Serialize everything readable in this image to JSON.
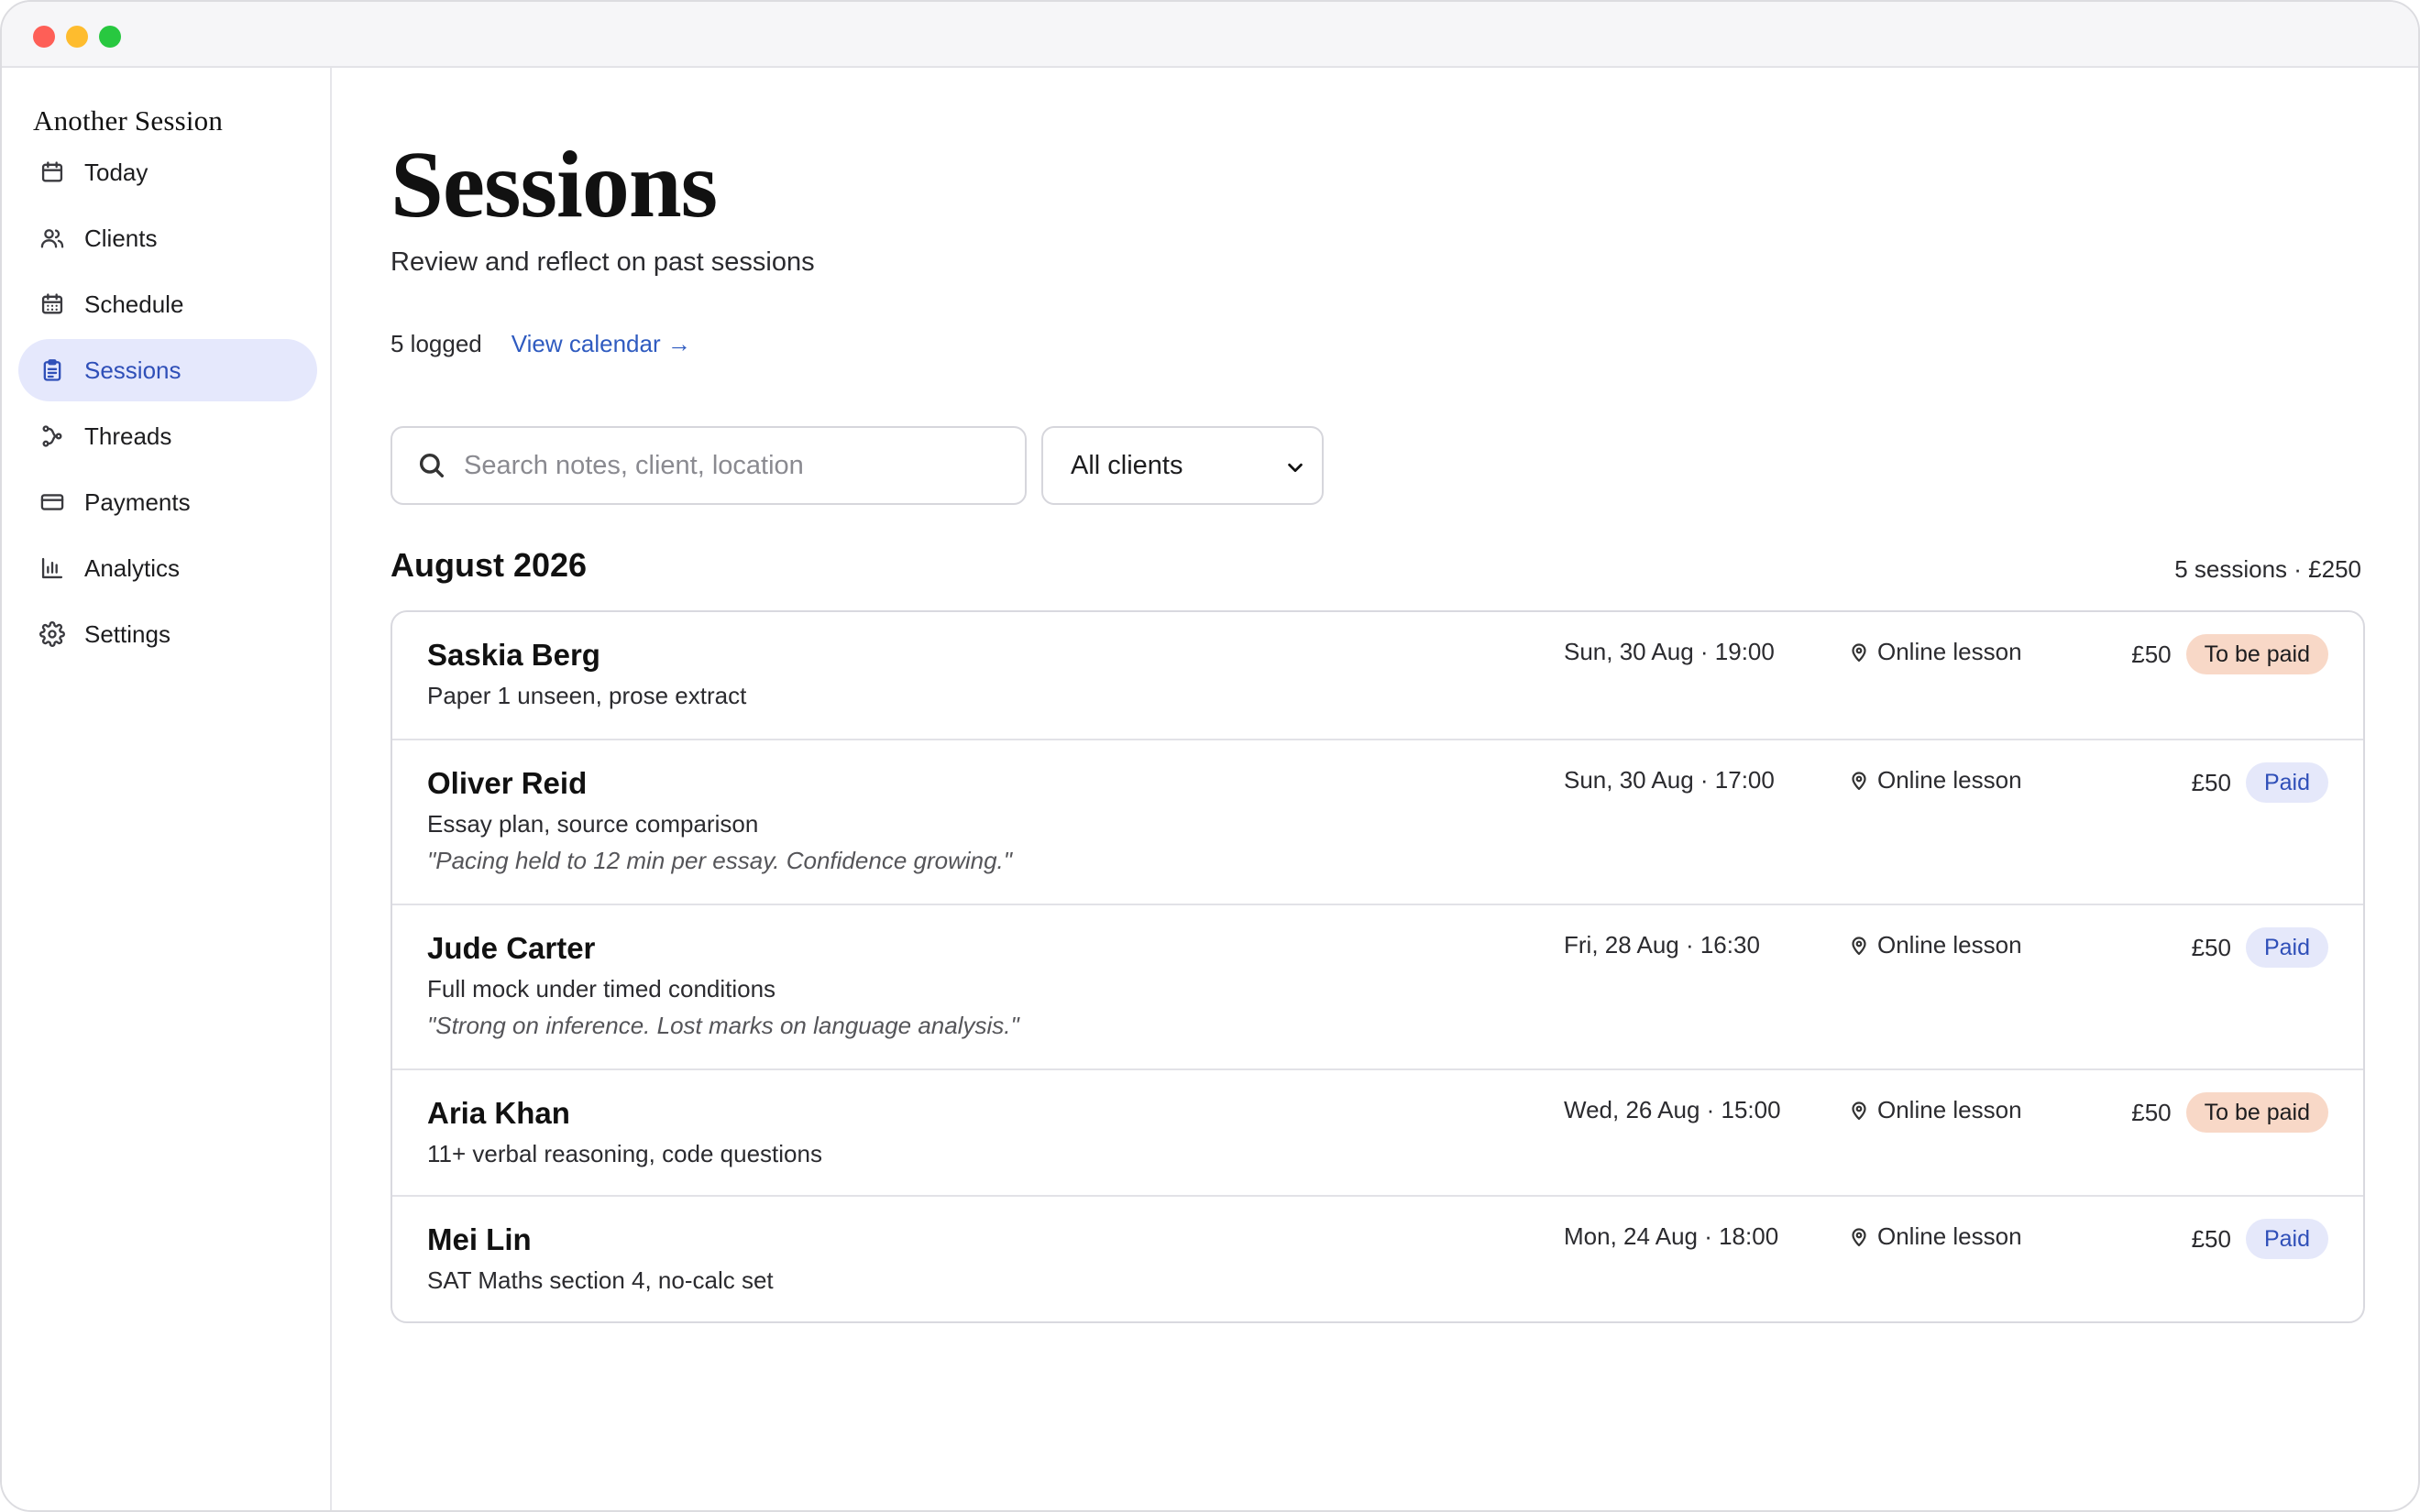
{
  "app": {
    "brand": "Another Session"
  },
  "window_controls": {
    "close": "close",
    "minimize": "minimize",
    "maximize": "maximize"
  },
  "sidebar": {
    "items": [
      {
        "label": "Today",
        "icon": "calendar-icon"
      },
      {
        "label": "Clients",
        "icon": "users-icon"
      },
      {
        "label": "Schedule",
        "icon": "calendar-grid-icon"
      },
      {
        "label": "Sessions",
        "icon": "clipboard-icon",
        "active": true
      },
      {
        "label": "Threads",
        "icon": "threads-icon"
      },
      {
        "label": "Payments",
        "icon": "credit-card-icon"
      },
      {
        "label": "Analytics",
        "icon": "bar-chart-icon"
      },
      {
        "label": "Settings",
        "icon": "gear-icon"
      }
    ]
  },
  "header": {
    "title": "Sessions",
    "subtitle": "Review and reflect on past sessions",
    "logged": "5 logged",
    "view_calendar": "View calendar →"
  },
  "filters": {
    "search_placeholder": "Search notes, client, location",
    "search_value": "",
    "client_select": "All clients"
  },
  "group": {
    "month": "August 2026",
    "summary": "5 sessions · £250"
  },
  "sessions": [
    {
      "name": "Saskia Berg",
      "topic": "Paper 1 unseen, prose extract",
      "note": "",
      "date": "Sun, 30 Aug · 19:00",
      "location": "Online lesson",
      "price": "£50",
      "status": "To be paid"
    },
    {
      "name": "Oliver Reid",
      "topic": "Essay plan, source comparison",
      "note": "\"Pacing held to 12 min per essay. Confidence growing.\"",
      "date": "Sun, 30 Aug · 17:00",
      "location": "Online lesson",
      "price": "£50",
      "status": "Paid"
    },
    {
      "name": "Jude Carter",
      "topic": "Full mock under timed conditions",
      "note": "\"Strong on inference. Lost marks on language analysis.\"",
      "date": "Fri, 28 Aug · 16:30",
      "location": "Online lesson",
      "price": "£50",
      "status": "Paid"
    },
    {
      "name": "Aria Khan",
      "topic": "11+ verbal reasoning, code questions",
      "note": "",
      "date": "Wed, 26 Aug · 15:00",
      "location": "Online lesson",
      "price": "£50",
      "status": "To be paid"
    },
    {
      "name": "Mei Lin",
      "topic": "SAT Maths section 4, no-calc set",
      "note": "",
      "date": "Mon, 24 Aug · 18:00",
      "location": "Online lesson",
      "price": "£50",
      "status": "Paid"
    }
  ],
  "colors": {
    "accent": "#2f4fb8",
    "active_nav_bg": "#e5e8fc",
    "badge_due_bg": "#f8d8c7",
    "badge_paid_bg": "#e5e8fa"
  }
}
